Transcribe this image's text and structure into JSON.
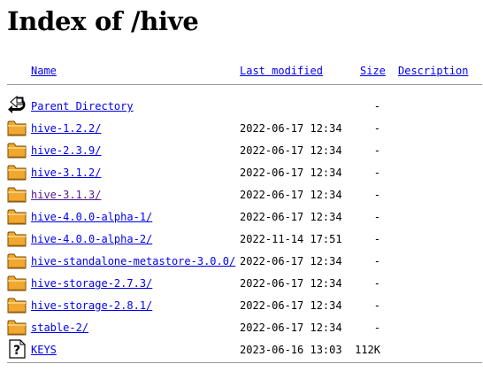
{
  "page": {
    "title": "Index of /hive"
  },
  "table": {
    "headers": {
      "name": "Name",
      "last_modified": "Last modified",
      "size": "Size",
      "description": "Description"
    },
    "parent": {
      "name": "Parent Directory",
      "date": "",
      "size": "-",
      "icon": "back-arrow-icon"
    },
    "rows": [
      {
        "name": "hive-1.2.2/",
        "date": "2022-06-17 12:34",
        "size": "-",
        "icon": "folder-icon",
        "visited": false
      },
      {
        "name": "hive-2.3.9/",
        "date": "2022-06-17 12:34",
        "size": "-",
        "icon": "folder-icon",
        "visited": false
      },
      {
        "name": "hive-3.1.2/",
        "date": "2022-06-17 12:34",
        "size": "-",
        "icon": "folder-icon",
        "visited": false
      },
      {
        "name": "hive-3.1.3/",
        "date": "2022-06-17 12:34",
        "size": "-",
        "icon": "folder-icon",
        "visited": true
      },
      {
        "name": "hive-4.0.0-alpha-1/",
        "date": "2022-06-17 12:34",
        "size": "-",
        "icon": "folder-icon",
        "visited": false
      },
      {
        "name": "hive-4.0.0-alpha-2/",
        "date": "2022-11-14 17:51",
        "size": "-",
        "icon": "folder-icon",
        "visited": false
      },
      {
        "name": "hive-standalone-metastore-3.0.0/",
        "date": "2022-06-17 12:34",
        "size": "-",
        "icon": "folder-icon",
        "visited": false
      },
      {
        "name": "hive-storage-2.7.3/",
        "date": "2022-06-17 12:34",
        "size": "-",
        "icon": "folder-icon",
        "visited": false
      },
      {
        "name": "hive-storage-2.8.1/",
        "date": "2022-06-17 12:34",
        "size": "-",
        "icon": "folder-icon",
        "visited": false
      },
      {
        "name": "stable-2/",
        "date": "2022-06-17 12:34",
        "size": "-",
        "icon": "folder-icon",
        "visited": false
      },
      {
        "name": "KEYS",
        "date": "2023-06-16 13:03",
        "size": "112K",
        "icon": "unknown-file-icon",
        "visited": false
      }
    ]
  },
  "colors": {
    "link": "#0000ee",
    "visited_link": "#551a8b",
    "rule": "#9a9a9a",
    "folder_fill": "#f0a830",
    "folder_outline": "#7a4a00"
  }
}
